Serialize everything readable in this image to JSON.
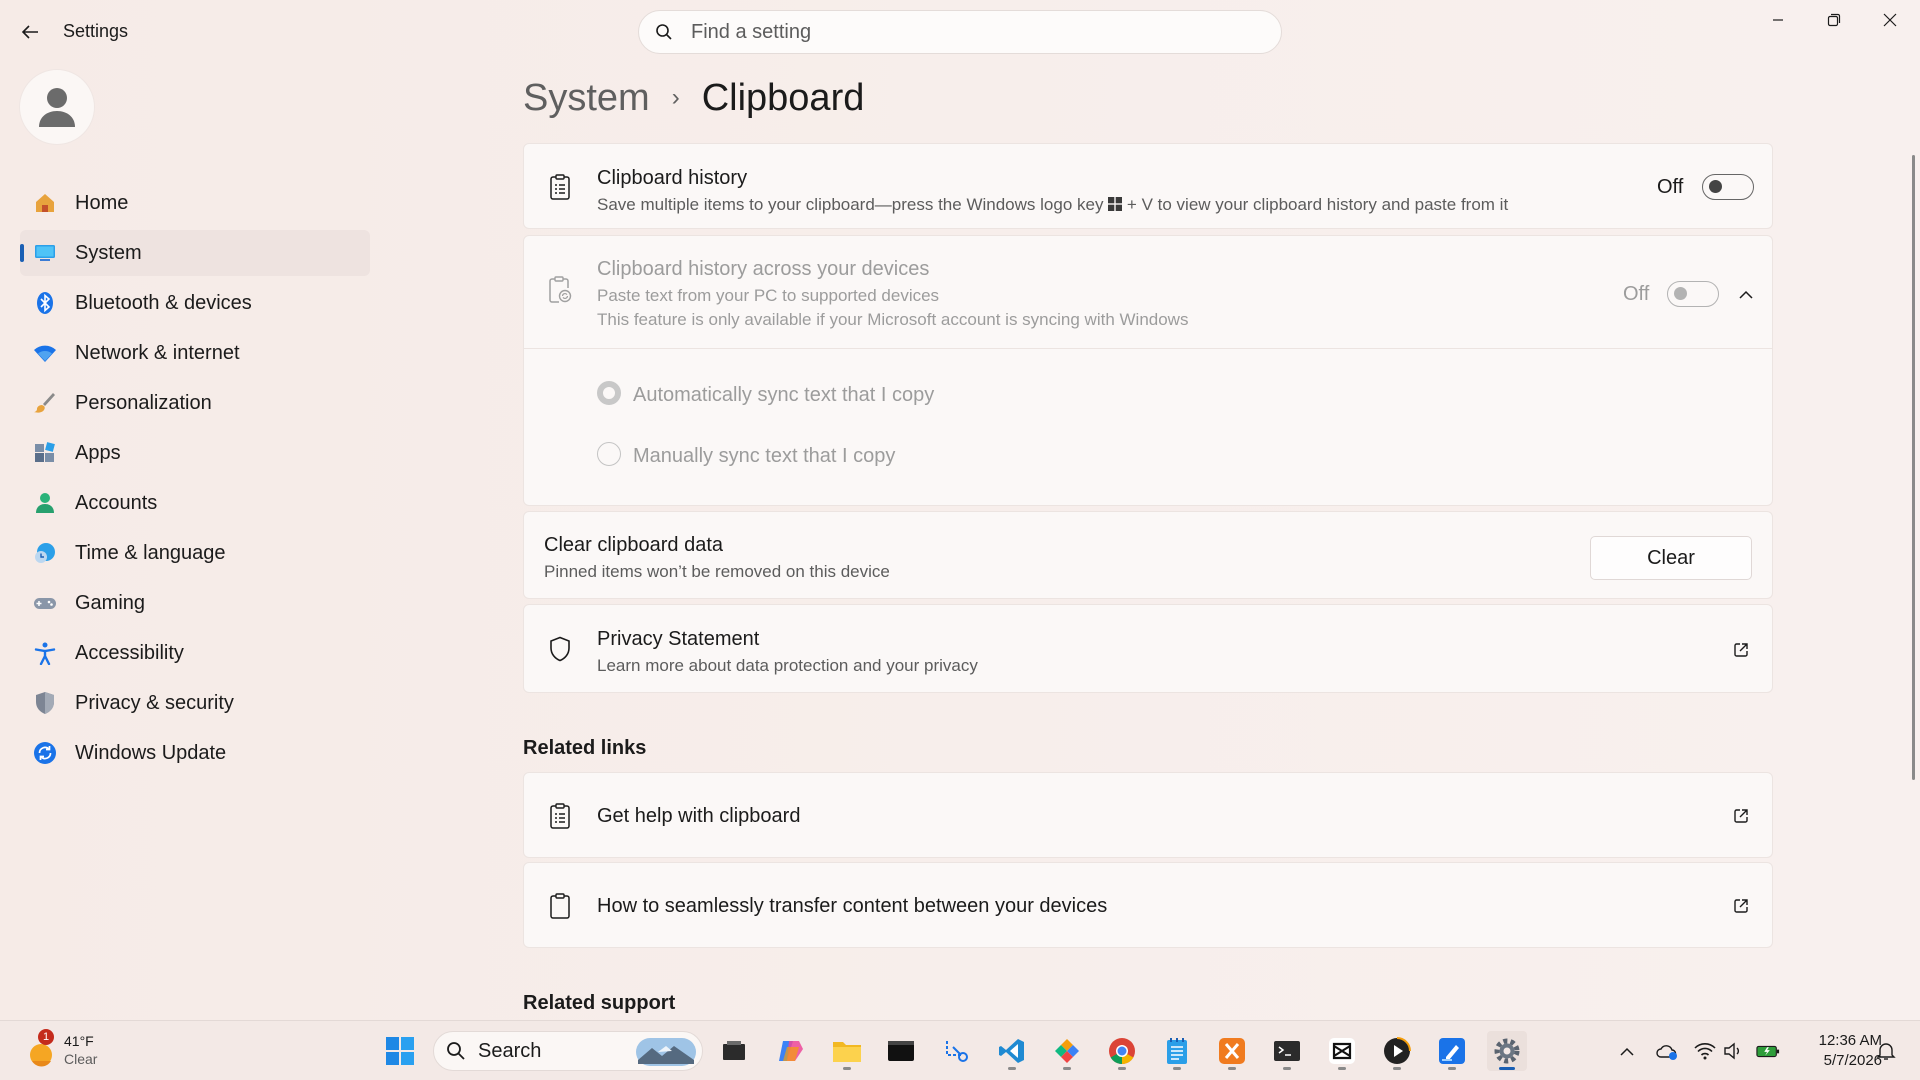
{
  "window": {
    "title": "Settings"
  },
  "search": {
    "placeholder": "Find a setting"
  },
  "nav": {
    "items": [
      {
        "label": "Home",
        "icon": "home-icon"
      },
      {
        "label": "System",
        "icon": "system-icon",
        "selected": true
      },
      {
        "label": "Bluetooth & devices",
        "icon": "bluetooth-icon"
      },
      {
        "label": "Network & internet",
        "icon": "wifi-icon"
      },
      {
        "label": "Personalization",
        "icon": "brush-icon"
      },
      {
        "label": "Apps",
        "icon": "apps-icon"
      },
      {
        "label": "Accounts",
        "icon": "accounts-icon"
      },
      {
        "label": "Time & language",
        "icon": "time-language-icon"
      },
      {
        "label": "Gaming",
        "icon": "gaming-icon"
      },
      {
        "label": "Accessibility",
        "icon": "accessibility-icon"
      },
      {
        "label": "Privacy & security",
        "icon": "shield-icon"
      },
      {
        "label": "Windows Update",
        "icon": "update-icon"
      }
    ]
  },
  "breadcrumb": {
    "parent": "System",
    "separator": "›",
    "current": "Clipboard"
  },
  "clipboard_history": {
    "title": "Clipboard history",
    "subtitle_before": "Save multiple items to your clipboard—press the Windows logo key",
    "subtitle_after": "+ V to view your clipboard history and paste from it",
    "toggle_label": "Off",
    "enabled": false
  },
  "cross_device": {
    "title": "Clipboard history across your devices",
    "subtitle1": "Paste text from your PC to supported devices",
    "subtitle2": "This feature is only available if your Microsoft account is syncing with Windows",
    "toggle_label": "Off",
    "enabled": false,
    "options": [
      {
        "label": "Automatically sync text that I copy",
        "checked": true
      },
      {
        "label": "Manually sync text that I copy",
        "checked": false
      }
    ]
  },
  "clear_data": {
    "title": "Clear clipboard data",
    "subtitle": "Pinned items won’t be removed on this device",
    "button": "Clear"
  },
  "privacy": {
    "title": "Privacy Statement",
    "subtitle": "Learn more about data protection and your privacy"
  },
  "related_links": {
    "heading": "Related links",
    "items": [
      {
        "label": "Get help with clipboard"
      },
      {
        "label": "How to seamlessly transfer content between your devices"
      }
    ]
  },
  "related_support": {
    "heading": "Related support"
  },
  "taskbar": {
    "weather": {
      "badge": "1",
      "temp": "41°F",
      "condition": "Clear"
    },
    "search_label": "Search",
    "clock": {
      "time": "12:36 AM",
      "date": "5/7/2026"
    }
  },
  "colors": {
    "accent": "#1a5fb4",
    "selected_bg": "#eee3e0",
    "card_bg": "#fbf8f7"
  }
}
